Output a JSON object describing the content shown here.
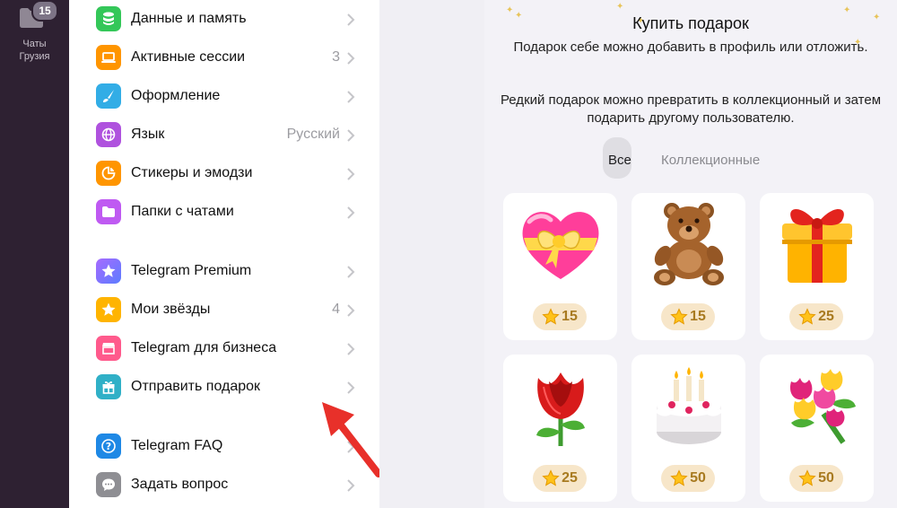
{
  "rail": {
    "badge": "15",
    "label_line1": "Чаты",
    "label_line2": "Грузия"
  },
  "settings": {
    "items": [
      {
        "label": "Данные и память",
        "value": "",
        "icon": "database-icon",
        "color": "#34c759"
      },
      {
        "label": "Активные сессии",
        "value": "3",
        "icon": "laptop-icon",
        "color": "#ff9500"
      },
      {
        "label": "Оформление",
        "value": "",
        "icon": "brush-icon",
        "color": "#32ade6"
      },
      {
        "label": "Язык",
        "value": "Русский",
        "icon": "globe-icon",
        "color": "#af52de"
      },
      {
        "label": "Стикеры и эмодзи",
        "value": "",
        "icon": "sticker-icon",
        "color": "#ff9500"
      },
      {
        "label": "Папки с чатами",
        "value": "",
        "icon": "folder-icon",
        "color": "#bf5af2"
      },
      {
        "label": "Telegram Premium",
        "value": "",
        "icon": "premium-star-icon",
        "color": "#7b61ff"
      },
      {
        "label": "Мои звёзды",
        "value": "4",
        "icon": "star-icon",
        "color": "#ffb400"
      },
      {
        "label": "Telegram для бизнеса",
        "value": "",
        "icon": "shop-icon",
        "color": "#ff5a8c"
      },
      {
        "label": "Отправить подарок",
        "value": "",
        "icon": "gift-icon",
        "color": "#30b0c7"
      },
      {
        "label": "Telegram FAQ",
        "value": "",
        "icon": "question-icon",
        "color": "#1e88e5"
      },
      {
        "label": "Задать вопрос",
        "value": "",
        "icon": "chat-bubble-icon",
        "color": "#8e8e93"
      }
    ]
  },
  "gift_panel": {
    "title": "Купить подарок",
    "desc1": "Подарок себе можно добавить в профиль или отложить.",
    "desc2": "Редкий подарок можно превратить в коллекционный и затем подарить другому пользователю.",
    "tabs": [
      "Все",
      "Коллекционные"
    ],
    "gifts": [
      {
        "emoji": "heart-gift-icon",
        "price": "15"
      },
      {
        "emoji": "teddy-bear-icon",
        "price": "15"
      },
      {
        "emoji": "gift-box-icon",
        "price": "25"
      },
      {
        "emoji": "rose-icon",
        "price": "25"
      },
      {
        "emoji": "birthday-cake-icon",
        "price": "50"
      },
      {
        "emoji": "bouquet-icon",
        "price": "50"
      }
    ]
  }
}
